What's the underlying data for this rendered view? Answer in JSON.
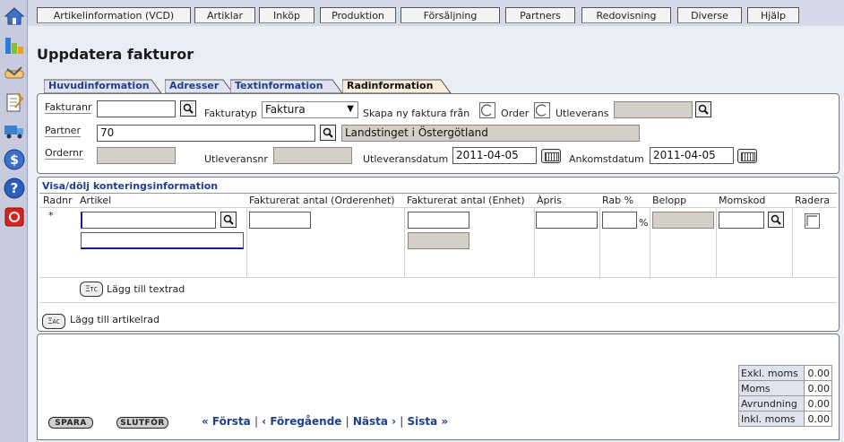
{
  "nav": {
    "tabs": [
      "Artikelinformation (VCD)",
      "Artiklar",
      "Inköp",
      "Produktion",
      "Försäljning",
      "Partners",
      "Redovisning",
      "Diverse",
      "Hjälp"
    ]
  },
  "page": {
    "title": "Uppdatera fakturor"
  },
  "subtabs": [
    "Huvudinformation",
    "Adresser",
    "Textinformation",
    "Radinformation"
  ],
  "form": {
    "fakturanr_label": "Fakturanr",
    "fakturanr_value": "",
    "fakturatyp_label": "Fakturatyp",
    "fakturatyp_value": "Faktura",
    "skapa_label": "Skapa ny faktura från",
    "order_label": "Order",
    "utleverans_label": "Utleverans",
    "partner_label": "Partner",
    "partner_value": "70",
    "partner_name": "Landstinget i Östergötland",
    "ordernr_label": "Ordernr",
    "utleveransnr_label": "Utleveransnr",
    "utleveransdatum_label": "Utleveransdatum",
    "utleveransdatum_value": "2011-04-05",
    "ankomstdatum_label": "Ankomstdatum",
    "ankomstdatum_value": "2011-04-05"
  },
  "rows": {
    "toggle_link": "Visa/dölj konteringsinformation",
    "columns": [
      "Radnr",
      "Artikel",
      "Fakturerat antal (Orderenhet)",
      "Fakturerat antal (Enhet)",
      "Àpris",
      "Rab %",
      "Belopp",
      "Momskod",
      "Radera"
    ],
    "new_row_marker": "*",
    "percent_sign": "%",
    "add_textrad": "Lägg till textrad",
    "add_artikelrad": "Lägg till artikelrad"
  },
  "footer": {
    "save": "SPARA",
    "finish": "SLUTFÖR",
    "first": "« Första",
    "prev": "‹ Föregående",
    "next": "Nästa ›",
    "last": "Sista »",
    "separator": "|"
  },
  "totals": [
    {
      "label": "Exkl. moms",
      "value": "0.00"
    },
    {
      "label": "Moms",
      "value": "0.00"
    },
    {
      "label": "Avrundning",
      "value": "0.00"
    },
    {
      "label": "Inkl. moms",
      "value": "0.00"
    }
  ],
  "colors": {
    "accent": "#1f3f8a",
    "panel_border": "#777777",
    "readonly": "#d4d0c8"
  }
}
